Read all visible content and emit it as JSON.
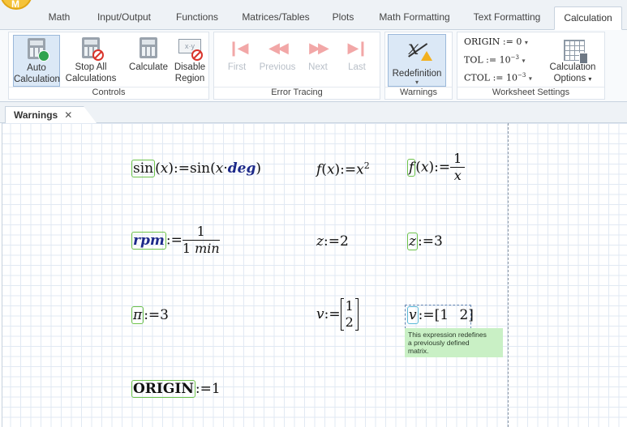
{
  "app": {
    "logo_letter": "M"
  },
  "tabs": [
    "Math",
    "Input/Output",
    "Functions",
    "Matrices/Tables",
    "Plots",
    "Math Formatting",
    "Text Formatting",
    "Calculation"
  ],
  "active_tab": "Calculation",
  "ribbon": {
    "controls": {
      "label": "Controls",
      "auto_calc": [
        "Auto",
        "Calculation"
      ],
      "stop_all": [
        "Stop All",
        "Calculations"
      ],
      "calculate": "Calculate",
      "disable_region": [
        "Disable",
        "Region"
      ]
    },
    "error_tracing": {
      "label": "Error Tracing",
      "buttons": [
        "First",
        "Previous",
        "Next",
        "Last"
      ]
    },
    "warnings": {
      "label": "Warnings",
      "redefinition": "Redefinition"
    },
    "worksheet_settings": {
      "label": "Worksheet Settings",
      "origin": {
        "name": "ORIGIN",
        "value": "0"
      },
      "tol": {
        "name": "TOL",
        "value": "10",
        "exp": "−3"
      },
      "ctol": {
        "name": "CTOL",
        "value": "10",
        "exp": "−3"
      },
      "calc_options": [
        "Calculation",
        "Options"
      ]
    }
  },
  "document": {
    "tab": "Warnings",
    "close": "✕"
  },
  "math": {
    "sin_def": {
      "lhs_fn": "sin",
      "var": "x",
      "rhs_fn": "sin",
      "unit": "deg"
    },
    "f_sq": {
      "fn": "f",
      "var": "x",
      "base": "x",
      "exp": "2"
    },
    "f_recip": {
      "fn": "f",
      "var": "x",
      "num": "1",
      "den": "x"
    },
    "rpm": {
      "name": "rpm",
      "num": "1",
      "den_num": "1",
      "den_unit": "min"
    },
    "z1": {
      "name": "z",
      "value": "2"
    },
    "z2": {
      "name": "z",
      "value": "3"
    },
    "pi_def": {
      "name": "π",
      "value": "3"
    },
    "v_col": {
      "name": "v",
      "values": [
        "1",
        "2"
      ]
    },
    "v_row": {
      "name": "v",
      "values": [
        "1",
        "2"
      ]
    },
    "origin_def": {
      "name": "ORIGIN",
      "value": "1"
    },
    "assign": ":="
  },
  "tooltip": {
    "lines": [
      "This expression redefines",
      "a previously defined",
      "matrix."
    ]
  }
}
